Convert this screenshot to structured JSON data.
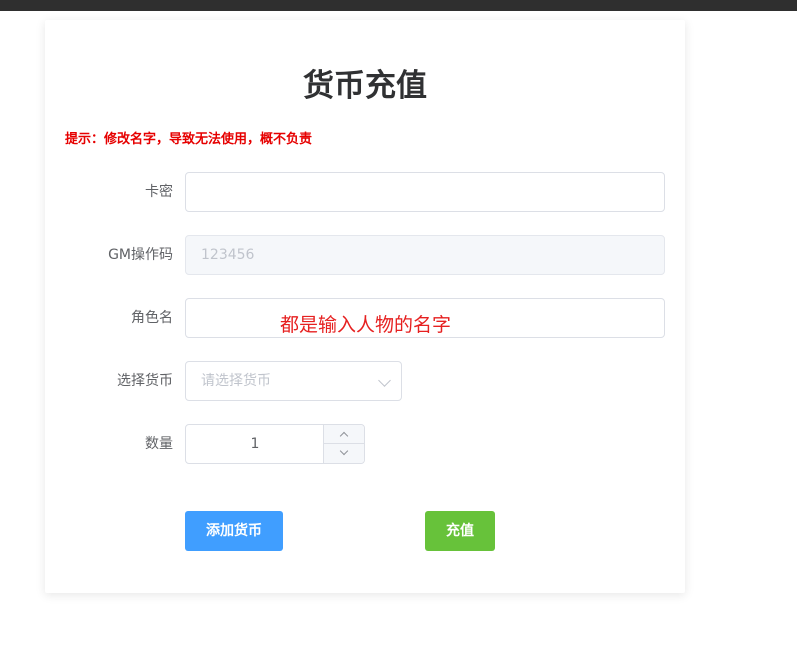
{
  "page": {
    "title": "货币充值",
    "tip": "提示：修改名字，导致无法使用，概不负责"
  },
  "form": {
    "card_key": {
      "label": "卡密",
      "value": ""
    },
    "gm_code": {
      "label": "GM操作码",
      "value": "123456"
    },
    "role_name": {
      "label": "角色名",
      "value": "",
      "note": "都是输入人物的名字"
    },
    "currency": {
      "label": "选择货币",
      "placeholder": "请选择货币"
    },
    "quantity": {
      "label": "数量",
      "value": "1"
    }
  },
  "actions": {
    "add_currency": "添加货币",
    "recharge": "充值"
  },
  "colors": {
    "primary": "#409eff",
    "success": "#67c23a",
    "warning_text": "#e60000"
  }
}
